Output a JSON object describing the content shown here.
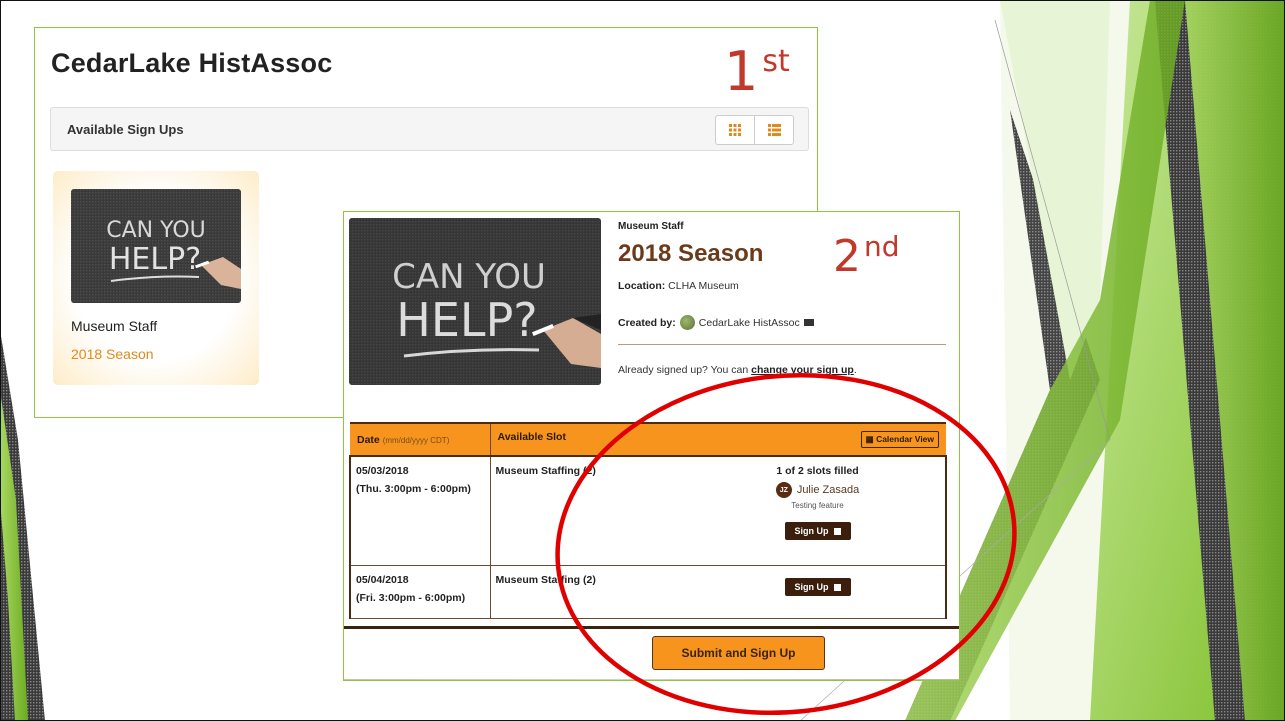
{
  "panel1": {
    "org_title": "CedarLake HistAssoc",
    "ordinal_number": "1",
    "ordinal_suffix": "st",
    "bar_label": "Available Sign Ups",
    "grid_icon": "grid-view-icon",
    "list_icon": "list-view-icon",
    "card": {
      "image_text_line1": "CAN YOU",
      "image_text_line2": "HELP?",
      "title": "Museum Staff",
      "subtitle": "2018 Season"
    }
  },
  "panel2": {
    "eyebrow": "Museum Staff",
    "title": "2018 Season",
    "ordinal_number": "2",
    "ordinal_suffix": "nd",
    "location_label": "Location:",
    "location_value": "CLHA Museum",
    "created_label": "Created by:",
    "created_value": "CedarLake HistAssoc",
    "already_text": "Already signed up? You can",
    "already_link": "change your sign up",
    "already_end": ".",
    "image_text_line1": "CAN YOU",
    "image_text_line2": "HELP?",
    "table": {
      "col_date": "Date",
      "col_date_hint": "(mm/dd/yyyy CDT)",
      "col_slot": "Available Slot",
      "calendar_view": "Calendar View",
      "rows": [
        {
          "date": "05/03/2018",
          "time": "(Thu. 3:00pm - 6:00pm)",
          "slot": "Museum Staffing (2)",
          "filled": "1 of 2 slots filled",
          "person_initials": "JZ",
          "person_name": "Julie Zasada",
          "person_note": "Testing feature",
          "signup": "Sign Up"
        },
        {
          "date": "05/04/2018",
          "time": "(Fri. 3:00pm - 6:00pm)",
          "slot": "Museum Staffing (2)",
          "signup": "Sign Up"
        }
      ]
    },
    "submit": "Submit and Sign Up"
  },
  "colors": {
    "accent_orange": "#f7941d",
    "brown": "#3b1e0c",
    "ordinal_red": "#c0392b",
    "highlight_circle": "#e00000",
    "slide_green": "#8dc63f"
  }
}
